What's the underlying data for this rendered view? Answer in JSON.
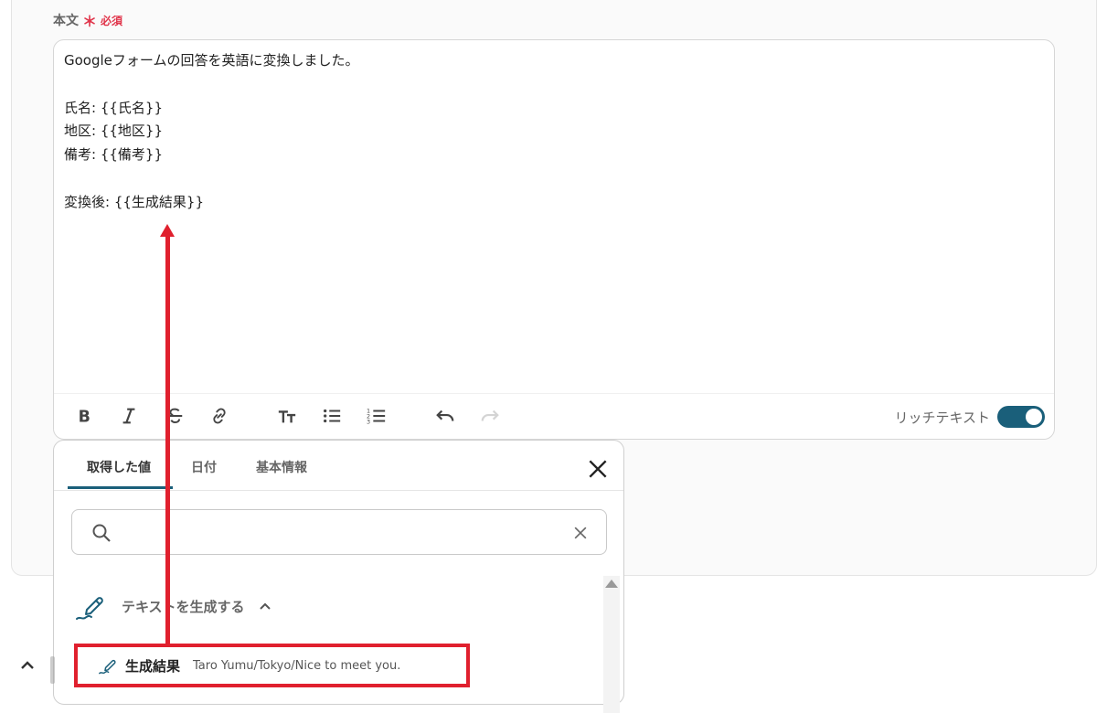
{
  "field": {
    "label": "本文",
    "required_mark": "＊",
    "required_text": "必須"
  },
  "editor": {
    "content": "Googleフォームの回答を英語に変換しました。\n\n氏名: {{氏名}}\n地区: {{地区}}\n備考: {{備考}}\n\n変換後: {{生成結果}}",
    "toolbar_icons": [
      "bold-icon",
      "italic-icon",
      "strikethrough-icon",
      "link-icon",
      "text-size-icon",
      "bullet-list-icon",
      "numbered-list-icon",
      "undo-icon",
      "redo-icon"
    ],
    "rich_text_label": "リッチテキスト",
    "rich_text_enabled": true
  },
  "popup": {
    "tabs": [
      {
        "label": "取得した値",
        "active": true
      },
      {
        "label": "日付",
        "active": false
      },
      {
        "label": "基本情報",
        "active": false
      }
    ],
    "search": {
      "value": "",
      "placeholder": ""
    },
    "group": {
      "label": "テキストを生成する",
      "expanded": true
    },
    "items": [
      {
        "label": "生成結果",
        "value": "Taro Yumu/Tokyo/Nice to meet you."
      }
    ]
  },
  "colors": {
    "accent": "#1a5f7a",
    "required": "#e0344a",
    "annotation": "#e0202e"
  }
}
